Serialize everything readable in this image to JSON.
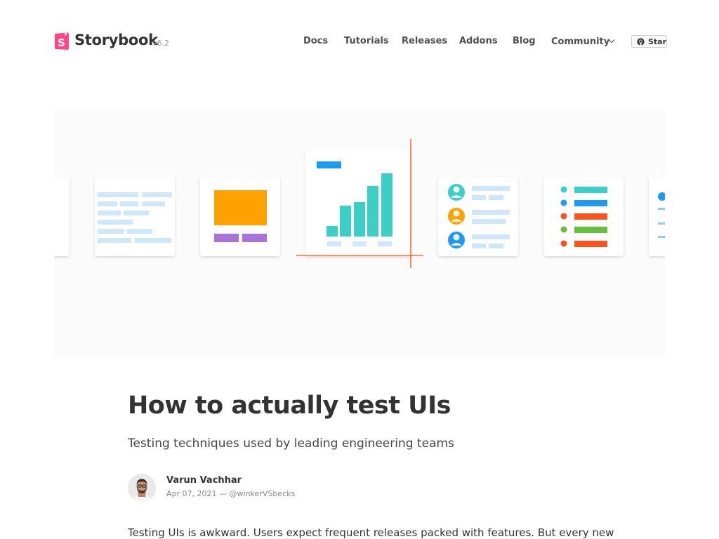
{
  "brand": {
    "name": "Storybook",
    "version": "v6.2",
    "accent_color": "#FF4785"
  },
  "nav": {
    "items": [
      "Docs",
      "Tutorials",
      "Releases",
      "Addons",
      "Blog",
      "Community"
    ],
    "star_label": "Star"
  },
  "hero": {
    "illustration": "ui-component-cards-with-chart-highlight",
    "colors": {
      "light_blue": "#cfe7fb",
      "orange": "#ffa200",
      "purple": "#a874db",
      "teal": "#3ccec7",
      "blue": "#1e9bf0",
      "red": "#fc521f",
      "green": "#66bf3c",
      "highlight": "#ff6a3d"
    }
  },
  "article": {
    "title": "How to actually test UIs",
    "subtitle": "Testing techniques used by leading engineering teams",
    "author": "Varun Vachhar",
    "date": "Apr 07, 2021",
    "separator": "—",
    "handle": "@winkerVSbecks",
    "body_start": "Testing UIs is awkward. Users expect frequent releases packed with features. But every new"
  }
}
